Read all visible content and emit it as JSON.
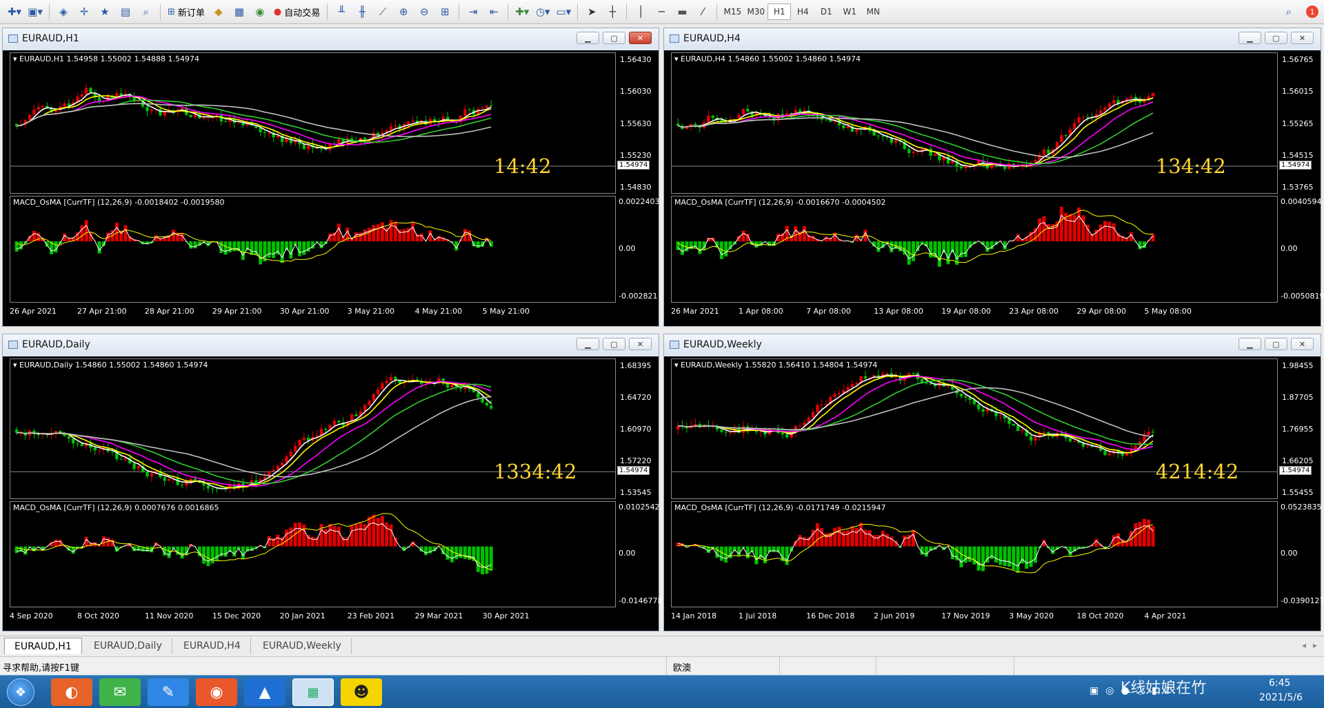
{
  "toolbar": {
    "new_order": "新订单",
    "auto_trade": "自动交易",
    "timeframes": [
      "M15",
      "M30",
      "H1",
      "H4",
      "D1",
      "W1",
      "MN"
    ],
    "active_tf": "H1",
    "notification_count": "1"
  },
  "windows": [
    {
      "title": "EURAUD,H1",
      "info": "EURAUD,H1  1.54958 1.55002 1.54888 1.54974",
      "prices": [
        "1.56430",
        "1.56030",
        "1.55630",
        "1.55230",
        "1.54830"
      ],
      "current": "1.54974",
      "timer": "14:42",
      "macd_label": "MACD_OsMA [CurrTF] (12,26,9) -0.0018402 -0.0019580",
      "macd_scale": [
        "0.0022403",
        "0.00",
        "-0.002821"
      ],
      "dates": [
        "26 Apr 2021",
        "27 Apr 21:00",
        "28 Apr 21:00",
        "29 Apr 21:00",
        "30 Apr 21:00",
        "3 May 21:00",
        "4 May 21:00",
        "5 May 21:00"
      ]
    },
    {
      "title": "EURAUD,H4",
      "info": "EURAUD,H4  1.54860 1.55002 1.54860 1.54974",
      "prices": [
        "1.56765",
        "1.56015",
        "1.55265",
        "1.54515",
        "1.53765"
      ],
      "current": "1.54974",
      "timer": "134:42",
      "macd_label": "MACD_OsMA [CurrTF] (12,26,9) -0.0016670 -0.0004502",
      "macd_scale": [
        "0.0040594",
        "0.00",
        "-0.0050819"
      ],
      "dates": [
        "26 Mar 2021",
        "1 Apr 08:00",
        "7 Apr 08:00",
        "13 Apr 08:00",
        "19 Apr 08:00",
        "23 Apr 08:00",
        "29 Apr 08:00",
        "5 May 08:00"
      ]
    },
    {
      "title": "EURAUD,Daily",
      "info": "EURAUD,Daily  1.54860 1.55002 1.54860 1.54974",
      "prices": [
        "1.68395",
        "1.64720",
        "1.60970",
        "1.57220",
        "1.53545"
      ],
      "current": "1.54974",
      "timer": "1334:42",
      "macd_label": "MACD_OsMA [CurrTF] (12,26,9) 0.0007676 0.0016865",
      "macd_scale": [
        "0.0102542",
        "0.00",
        "-0.0146778"
      ],
      "dates": [
        "4 Sep 2020",
        "8 Oct 2020",
        "11 Nov 2020",
        "15 Dec 2020",
        "20 Jan 2021",
        "23 Feb 2021",
        "29 Mar 2021",
        "30 Apr 2021"
      ]
    },
    {
      "title": "EURAUD,Weekly",
      "info": "EURAUD,Weekly  1.55820 1.56410 1.54804 1.54974",
      "prices": [
        "1.98455",
        "1.87705",
        "1.76955",
        "1.66205",
        "1.55455"
      ],
      "current": "1.54974",
      "timer": "4214:42",
      "macd_label": "MACD_OsMA [CurrTF] (12,26,9) -0.0171749 -0.0215947",
      "macd_scale": [
        "0.0523835",
        "0.00",
        "-0.0390127"
      ],
      "dates": [
        "14 Jan 2018",
        "1 Jul 2018",
        "16 Dec 2018",
        "2 Jun 2019",
        "17 Nov 2019",
        "3 May 2020",
        "18 Oct 2020",
        "4 Apr 2021"
      ]
    }
  ],
  "tabs": [
    "EURAUD,H1",
    "EURAUD,Daily",
    "EURAUD,H4",
    "EURAUD,Weekly"
  ],
  "status": {
    "help": "寻求帮助,请按F1键",
    "profile": "欧澳"
  },
  "taskbar": {
    "time": "6:45",
    "date": "2021/5/6",
    "watermark": "K线姑娘在竹"
  },
  "colors": {
    "bull": "#e00000",
    "bear": "#00c000",
    "ma_white": "#ffffff",
    "ma_yellow": "#ffff00",
    "ma_magenta": "#ff00ff",
    "ma_green": "#32cd32",
    "ma_gray": "#c0c0c0",
    "timer": "#ffd633"
  }
}
